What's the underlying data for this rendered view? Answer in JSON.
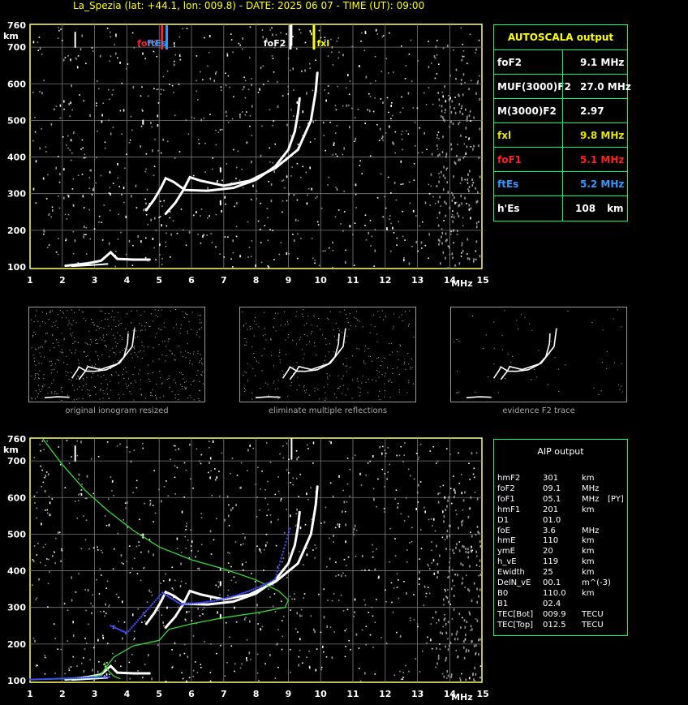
{
  "header": {
    "title": "La_Spezia (lat: +44.1, lon: 009.8) - DATE: 2025 06 07 - TIME (UT): 09:00"
  },
  "axes": {
    "y_unit": "km",
    "x_unit": "MHz",
    "y_ticks": [
      "100",
      "200",
      "300",
      "400",
      "500",
      "600",
      "700",
      "760"
    ],
    "x_ticks": [
      "1",
      "2",
      "3",
      "4",
      "5",
      "6",
      "7",
      "8",
      "9",
      "10",
      "11",
      "12",
      "13",
      "14",
      "15"
    ]
  },
  "markers": {
    "fof1": "foF1",
    "ftes": "ftEs",
    "fof2": "foF2",
    "fxl": "fxl"
  },
  "autoscala": {
    "title": "AUTOSCALA output",
    "rows": [
      {
        "label": "foF2",
        "value": "9.1 MHz",
        "color": "#ffffff"
      },
      {
        "label": "MUF(3000)F2",
        "value": "27.0 MHz",
        "color": "#ffffff"
      },
      {
        "label": "M(3000)F2",
        "value": "2.97",
        "color": "#ffffff"
      },
      {
        "label": "fxl",
        "value": "9.8 MHz",
        "color": "#e6e600"
      },
      {
        "label": "foF1",
        "value": "5.1 MHz",
        "color": "#ff2020"
      },
      {
        "label": "ftEs",
        "value": "5.2 MHz",
        "color": "#3399ff"
      },
      {
        "label": "h'Es",
        "value": "108",
        "unit": "km",
        "color": "#ffffff"
      }
    ]
  },
  "thumbnails": [
    {
      "caption": "original ionogram resized"
    },
    {
      "caption": "eliminate multiple reflections"
    },
    {
      "caption": "evidence F2 trace"
    }
  ],
  "aip": {
    "title": "AIP output",
    "rows": [
      {
        "name": "hmF2",
        "value": "301",
        "unit": "km",
        "extra": ""
      },
      {
        "name": "foF2",
        "value": "09.1",
        "unit": "MHz",
        "extra": ""
      },
      {
        "name": "foF1",
        "value": "05.1",
        "unit": "MHz",
        "extra": "[PY]"
      },
      {
        "name": "hmF1",
        "value": "201",
        "unit": "km",
        "extra": ""
      },
      {
        "name": "D1",
        "value": "01.0",
        "unit": "",
        "extra": ""
      },
      {
        "name": "foE",
        "value": "3.6",
        "unit": "MHz",
        "extra": ""
      },
      {
        "name": "hmE",
        "value": "110",
        "unit": "km",
        "extra": ""
      },
      {
        "name": "ymE",
        "value": "20",
        "unit": "km",
        "extra": ""
      },
      {
        "name": "h_vE",
        "value": "119",
        "unit": "km",
        "extra": ""
      },
      {
        "name": "Ewidth",
        "value": "25",
        "unit": "km",
        "extra": ""
      },
      {
        "name": "DelN_vE",
        "value": "00.1",
        "unit": "m^(-3)",
        "extra": ""
      },
      {
        "name": "B0",
        "value": "110.0",
        "unit": "km",
        "extra": ""
      },
      {
        "name": "B1",
        "value": "02.4",
        "unit": "",
        "extra": ""
      },
      {
        "name": "TEC[Bot]",
        "value": "009.9",
        "unit": "TECU",
        "extra": ""
      },
      {
        "name": "TEC[Top]",
        "value": "012.5",
        "unit": "TECU",
        "extra": ""
      }
    ]
  }
}
